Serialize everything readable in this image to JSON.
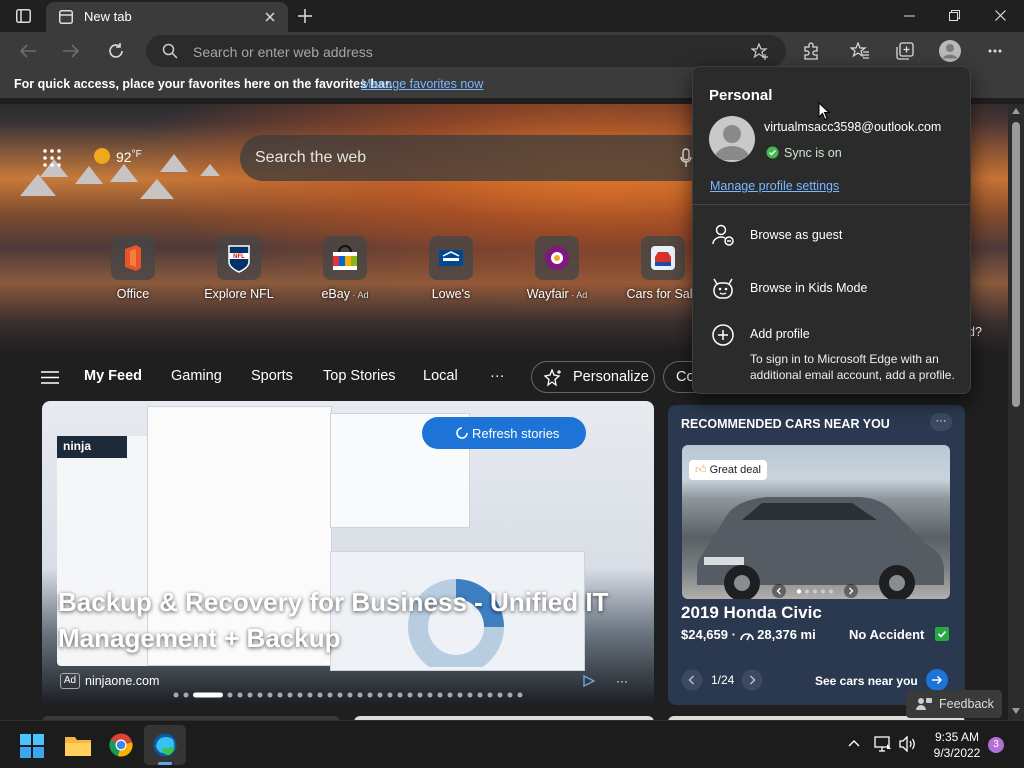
{
  "browser": {
    "tab_title": "New tab",
    "address_placeholder": "Search or enter web address"
  },
  "favorites_bar": {
    "message": "For quick access, place your favorites here on the favorites bar.",
    "link": "Manage favorites now"
  },
  "hero": {
    "weather": "92",
    "weather_unit": "°F",
    "search_placeholder": "Search the web",
    "quick_links": [
      {
        "name": "Office",
        "ad": ""
      },
      {
        "name": "Explore NFL",
        "ad": ""
      },
      {
        "name": "eBay",
        "ad": " · Ad"
      },
      {
        "name": "Lowe's",
        "ad": ""
      },
      {
        "name": "Wayfair",
        "ad": " · Ad"
      },
      {
        "name": "Cars for Sale",
        "ad": ""
      }
    ],
    "right_edge_text": "d?"
  },
  "feed_nav": {
    "items": [
      "My Feed",
      "Gaming",
      "Sports",
      "Top Stories",
      "Local"
    ],
    "more": "···",
    "personalize": "Personalize",
    "partial": "Co"
  },
  "main_card": {
    "headline": "Backup & Recovery for Business - Unified IT Management + Backup",
    "ad_badge": "Ad",
    "source": "ninjaone.com",
    "brand": "ninja",
    "refresh_label": "Refresh stories",
    "more": "···"
  },
  "cars_card": {
    "header": "RECOMMENDED CARS NEAR YOU",
    "badge": "Great deal",
    "model": "2019 Honda Civic",
    "price": "$24,659 · ",
    "mileage": "28,376 mi",
    "condition": "No Accident",
    "pager": "1/24",
    "see_cars": "See cars near you",
    "more": "···"
  },
  "feedback": "Feedback",
  "profile_flyout": {
    "title": "Personal",
    "email": "virtualmsacc3598@outlook.com",
    "sync_status": "Sync is on",
    "manage_link": "Manage profile settings",
    "browse_guest": "Browse as guest",
    "browse_kids": "Browse in Kids Mode",
    "add_profile": "Add profile",
    "add_profile_hint": "To sign in to Microsoft Edge with an additional email account, add a profile."
  },
  "taskbar": {
    "time": "9:35 AM",
    "date": "9/3/2022",
    "notification_count": "3"
  },
  "colors": {
    "accent_blue": "#1e73d6",
    "link_blue": "#79b8ff",
    "sync_green": "#3fb950",
    "cars_card_bg": "#2b3950"
  }
}
